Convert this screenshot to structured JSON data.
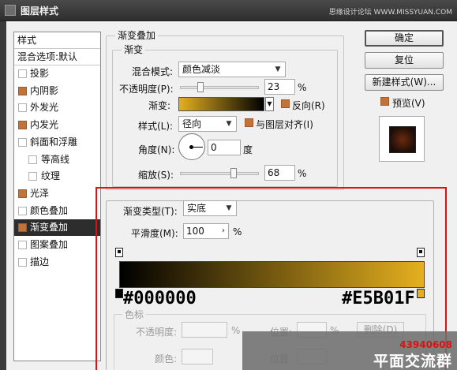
{
  "window": {
    "title": "图层样式",
    "watermark": "思缘设计论坛 WWW.MISSYUAN.COM"
  },
  "left_panel": {
    "header": "样式",
    "blend_options": "混合选项:默认",
    "items": [
      {
        "label": "投影",
        "checked": false,
        "sub": false
      },
      {
        "label": "内阴影",
        "checked": true,
        "sub": false
      },
      {
        "label": "外发光",
        "checked": false,
        "sub": false
      },
      {
        "label": "内发光",
        "checked": true,
        "sub": false
      },
      {
        "label": "斜面和浮雕",
        "checked": false,
        "sub": false
      },
      {
        "label": "等高线",
        "checked": false,
        "sub": true
      },
      {
        "label": "纹理",
        "checked": false,
        "sub": true
      },
      {
        "label": "光泽",
        "checked": true,
        "sub": false
      },
      {
        "label": "颜色叠加",
        "checked": false,
        "sub": false
      },
      {
        "label": "渐变叠加",
        "checked": true,
        "sub": false,
        "selected": true
      },
      {
        "label": "图案叠加",
        "checked": false,
        "sub": false
      },
      {
        "label": "描边",
        "checked": false,
        "sub": false
      }
    ]
  },
  "gradient_overlay": {
    "group_title": "渐变叠加",
    "sub_title": "渐变",
    "blend_mode_label": "混合模式:",
    "blend_mode_value": "颜色减淡",
    "opacity_label": "不透明度(P):",
    "opacity_value": "23",
    "opacity_level": 23,
    "percent": "%",
    "gradient_label": "渐变:",
    "reverse_label": "反向(R)",
    "style_label": "样式(L):",
    "style_value": "径向",
    "align_label": "与图层对齐(I)",
    "angle_label": "角度(N):",
    "angle_value": "0",
    "degree": "度",
    "scale_label": "缩放(S):",
    "scale_value": "68",
    "scale_level": 68
  },
  "buttons": {
    "ok": "确定",
    "reset": "复位",
    "new_style": "新建样式(W)...",
    "preview": "预览(V)"
  },
  "gradient_editor": {
    "type_label": "渐变类型(T):",
    "type_value": "实底",
    "smooth_label": "平滑度(M):",
    "smooth_value": "100",
    "percent": "%",
    "stop_left_color": "#000000",
    "stop_right_color": "#E5B01F",
    "left_hex_label": "#000000",
    "right_hex_label": "#E5B01F",
    "stops_group": "色标",
    "opacity_label": "不透明度:",
    "position_label": "位置:",
    "color_label": "颜色:",
    "delete_label": "删除(D)"
  },
  "overlay_brand": {
    "code": "43940608",
    "name": "平面交流群"
  },
  "colors": {
    "checked": "#c0733a",
    "highlight": "#e01010",
    "gold": "#e5b01f"
  }
}
